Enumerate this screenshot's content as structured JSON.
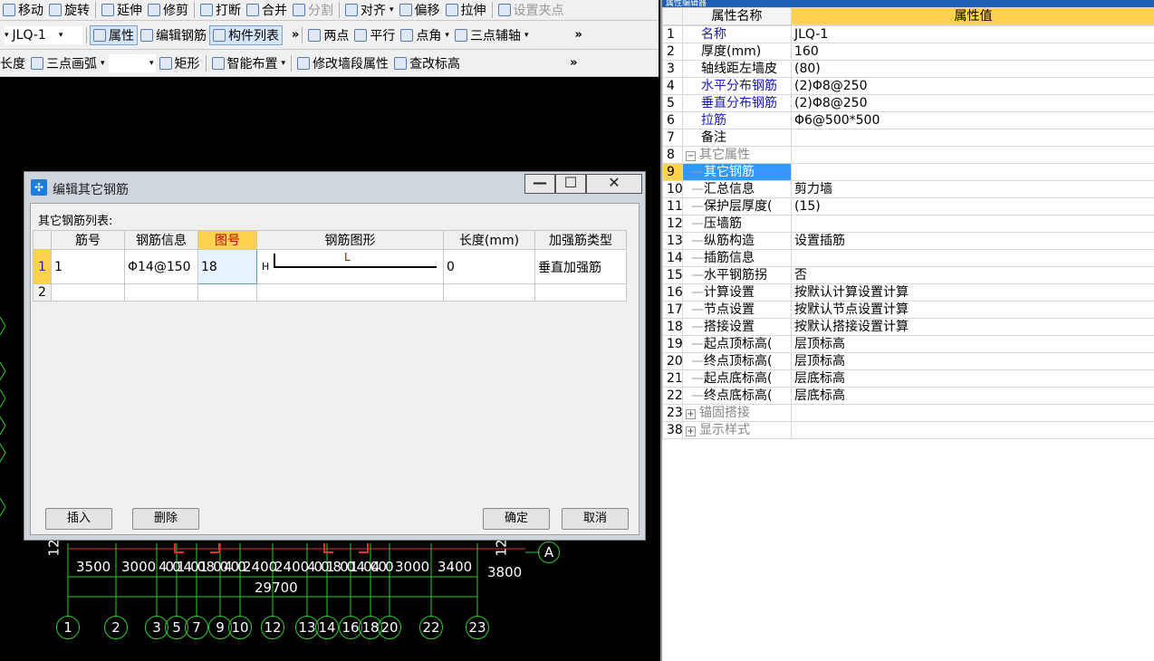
{
  "toolbar1": {
    "move": "移动",
    "rotate": "旋转",
    "extend": "延伸",
    "trim": "修剪",
    "break": "打断",
    "merge": "合并",
    "split": "分割",
    "align": "对齐",
    "offset": "偏移",
    "stretch": "拉伸",
    "set_grip": "设置夹点"
  },
  "toolbar2": {
    "component": "JLQ-1",
    "properties": "属性",
    "edit_rebar": "编辑钢筋",
    "component_list": "构件列表",
    "two_points": "两点",
    "parallel": "平行",
    "point_angle": "点角",
    "three_point_aux": "三点辅轴"
  },
  "toolbar3": {
    "length": "长度",
    "three_point_arc": "三点画弧",
    "rectangle": "矩形",
    "smart_layout": "智能布置",
    "modify_wall_seg": "修改墙段属性",
    "check_elev": "查改标高"
  },
  "props_panel": {
    "title": "属性编辑器",
    "header_name": "属性名称",
    "header_value": "属性值",
    "rows": [
      {
        "num": "1",
        "name": "名称",
        "value": "JLQ-1"
      },
      {
        "num": "2",
        "name": "厚度(mm)",
        "value": "160"
      },
      {
        "num": "3",
        "name": "轴线距左墙皮",
        "value": "(80)"
      },
      {
        "num": "4",
        "name": "水平分布钢筋",
        "value": "(2)Φ8@250"
      },
      {
        "num": "5",
        "name": "垂直分布钢筋",
        "value": "(2)Φ8@250"
      },
      {
        "num": "6",
        "name": "拉筋",
        "value": "Φ6@500*500"
      },
      {
        "num": "7",
        "name": "备注",
        "value": ""
      },
      {
        "num": "8",
        "name": "其它属性",
        "value": ""
      },
      {
        "num": "9",
        "name": "其它钢筋",
        "value": ""
      },
      {
        "num": "10",
        "name": "汇总信息",
        "value": "剪力墙"
      },
      {
        "num": "11",
        "name": "保护层厚度(",
        "value": "(15)"
      },
      {
        "num": "12",
        "name": "压墙筋",
        "value": ""
      },
      {
        "num": "13",
        "name": "纵筋构造",
        "value": "设置插筋"
      },
      {
        "num": "14",
        "name": "插筋信息",
        "value": ""
      },
      {
        "num": "15",
        "name": "水平钢筋拐",
        "value": "否"
      },
      {
        "num": "16",
        "name": "计算设置",
        "value": "按默认计算设置计算"
      },
      {
        "num": "17",
        "name": "节点设置",
        "value": "按默认节点设置计算"
      },
      {
        "num": "18",
        "name": "搭接设置",
        "value": "按默认搭接设置计算"
      },
      {
        "num": "19",
        "name": "起点顶标高(",
        "value": "层顶标高"
      },
      {
        "num": "20",
        "name": "终点顶标高(",
        "value": "层顶标高"
      },
      {
        "num": "21",
        "name": "起点底标高(",
        "value": "层底标高"
      },
      {
        "num": "22",
        "name": "终点底标高(",
        "value": "层底标高"
      },
      {
        "num": "23",
        "name": "锚固搭接",
        "value": ""
      },
      {
        "num": "38",
        "name": "显示样式",
        "value": ""
      }
    ]
  },
  "dialog": {
    "title": "编辑其它钢筋",
    "list_label": "其它钢筋列表:",
    "columns": [
      "筋号",
      "钢筋信息",
      "图号",
      "钢筋图形",
      "长度(mm)",
      "加强筋类型"
    ],
    "rows": [
      {
        "row": "1",
        "bar_no": "1",
        "info": "Φ14@150",
        "fig": "18",
        "shape_h": "H",
        "shape_l": "L",
        "length": "0",
        "type": "垂直加强筋"
      },
      {
        "row": "2",
        "bar_no": "",
        "info": "",
        "fig": "",
        "shape_h": "",
        "shape_l": "",
        "length": "",
        "type": ""
      }
    ],
    "insert": "插入",
    "delete": "删除",
    "ok": "确定",
    "cancel": "取消",
    "min": "—",
    "max": "☐",
    "close": "✕"
  },
  "cad": {
    "dims": [
      "3500",
      "3000",
      "400",
      "1400",
      "1800",
      "400",
      "2400",
      "2400",
      "400",
      "1800",
      "1400",
      "400",
      "3000",
      "3400",
      "3800",
      "29700"
    ],
    "side_labels": [
      "12",
      "12"
    ],
    "axis_letter": "A",
    "axes": [
      "1",
      "2",
      "3",
      "5",
      "7",
      "9",
      "10",
      "12",
      "13",
      "14",
      "16",
      "18",
      "20",
      "22",
      "23"
    ]
  },
  "colors": {
    "accent": "#ffd24d",
    "selection": "#3399ff",
    "title_blue": "#1e5fb8",
    "grid_green": "#2ecc2e"
  }
}
